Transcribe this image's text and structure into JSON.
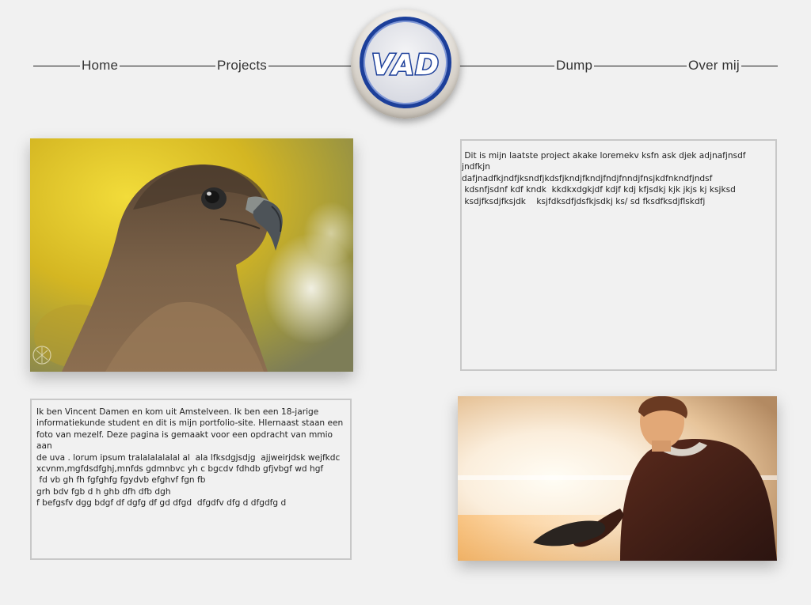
{
  "nav": {
    "home": "Home",
    "projects": "Projects",
    "dump": "Dump",
    "over_mij": "Over mij"
  },
  "logo": {
    "text": "VAD"
  },
  "project_panel": {
    "text": " Dit is mijn laatste project akake loremekv ksfn ask djek adjnafjnsdf jndfkjn\ndafjnadfkjndfjksndfjkdsfjkndjfkndjfndjfnndjfnsjkdfnkndfjndsf\n kdsnfjsdnf kdf kndk  kkdkxdgkjdf kdjf kdj kfjsdkj kjk jkjs kj ksjksd\n ksdjfksdjfksjdk    ksjfdksdfjdsfkjsdkj ks/ sd fksdfksdjflskdfj"
  },
  "about_panel": {
    "text": "Ik ben Vincent Damen en kom uit Amstelveen. Ik ben een 18-jarige\ninformatiekunde student en dit is mijn portfolio-site. HIernaast staan een\nfoto van mezelf. Deze pagina is gemaakt voor een opdracht van mmio aan\nde uva . lorum ipsum tralalalalalal al  ala lfksdgjsdjg  ajjweirjdsk wejfkdc\nxcvnm,mgfdsdfghj,mnfds gdmnbvc yh c bgcdv fdhdb gfjvbgf wd hgf\n fd vb gh fh fgfghfg fgydvb efghvf fgn fb\ngrh bdv fgb d h ghb dfh dfb dgh\nf befgsfv dgg bdgf df dgfg df gd dfgd  dfgdfv dfg d dfgdfg d"
  },
  "colors": {
    "background": "#f1f1f1",
    "logo_blue": "#1c3f9a",
    "panel_border": "#c8c8c8"
  },
  "images": {
    "eagle": "eagle-photo",
    "portrait": "portrait-photo"
  }
}
